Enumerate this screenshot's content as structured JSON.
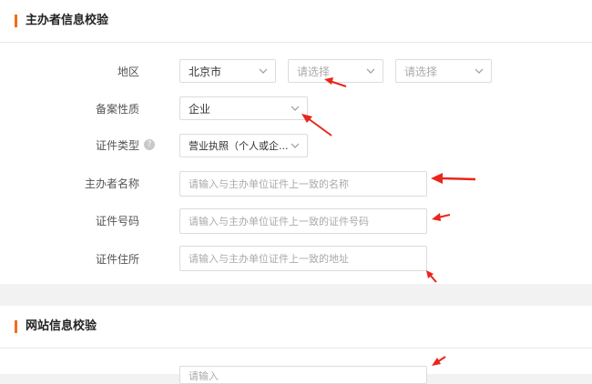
{
  "section1": {
    "title": "主办者信息校验",
    "region": {
      "label": "地区",
      "province": "北京市",
      "city_placeholder": "请选择",
      "district_placeholder": "请选择"
    },
    "nature": {
      "label": "备案性质",
      "value": "企业"
    },
    "cert_type": {
      "label": "证件类型",
      "help_icon": "question-icon",
      "value": "营业执照（个人或企..."
    },
    "sponsor_name": {
      "label": "主办者名称",
      "placeholder": "请输入与主办单位证件上一致的名称"
    },
    "cert_number": {
      "label": "证件号码",
      "placeholder": "请输入与主办单位证件上一致的证件号码"
    },
    "cert_address": {
      "label": "证件住所",
      "placeholder": "请输入与主办单位证件上一致的地址"
    }
  },
  "section2": {
    "title": "网站信息校验",
    "partial_placeholder": "请输入"
  },
  "colors": {
    "accent": "#f26b1d",
    "arrow": "#e8261c"
  }
}
